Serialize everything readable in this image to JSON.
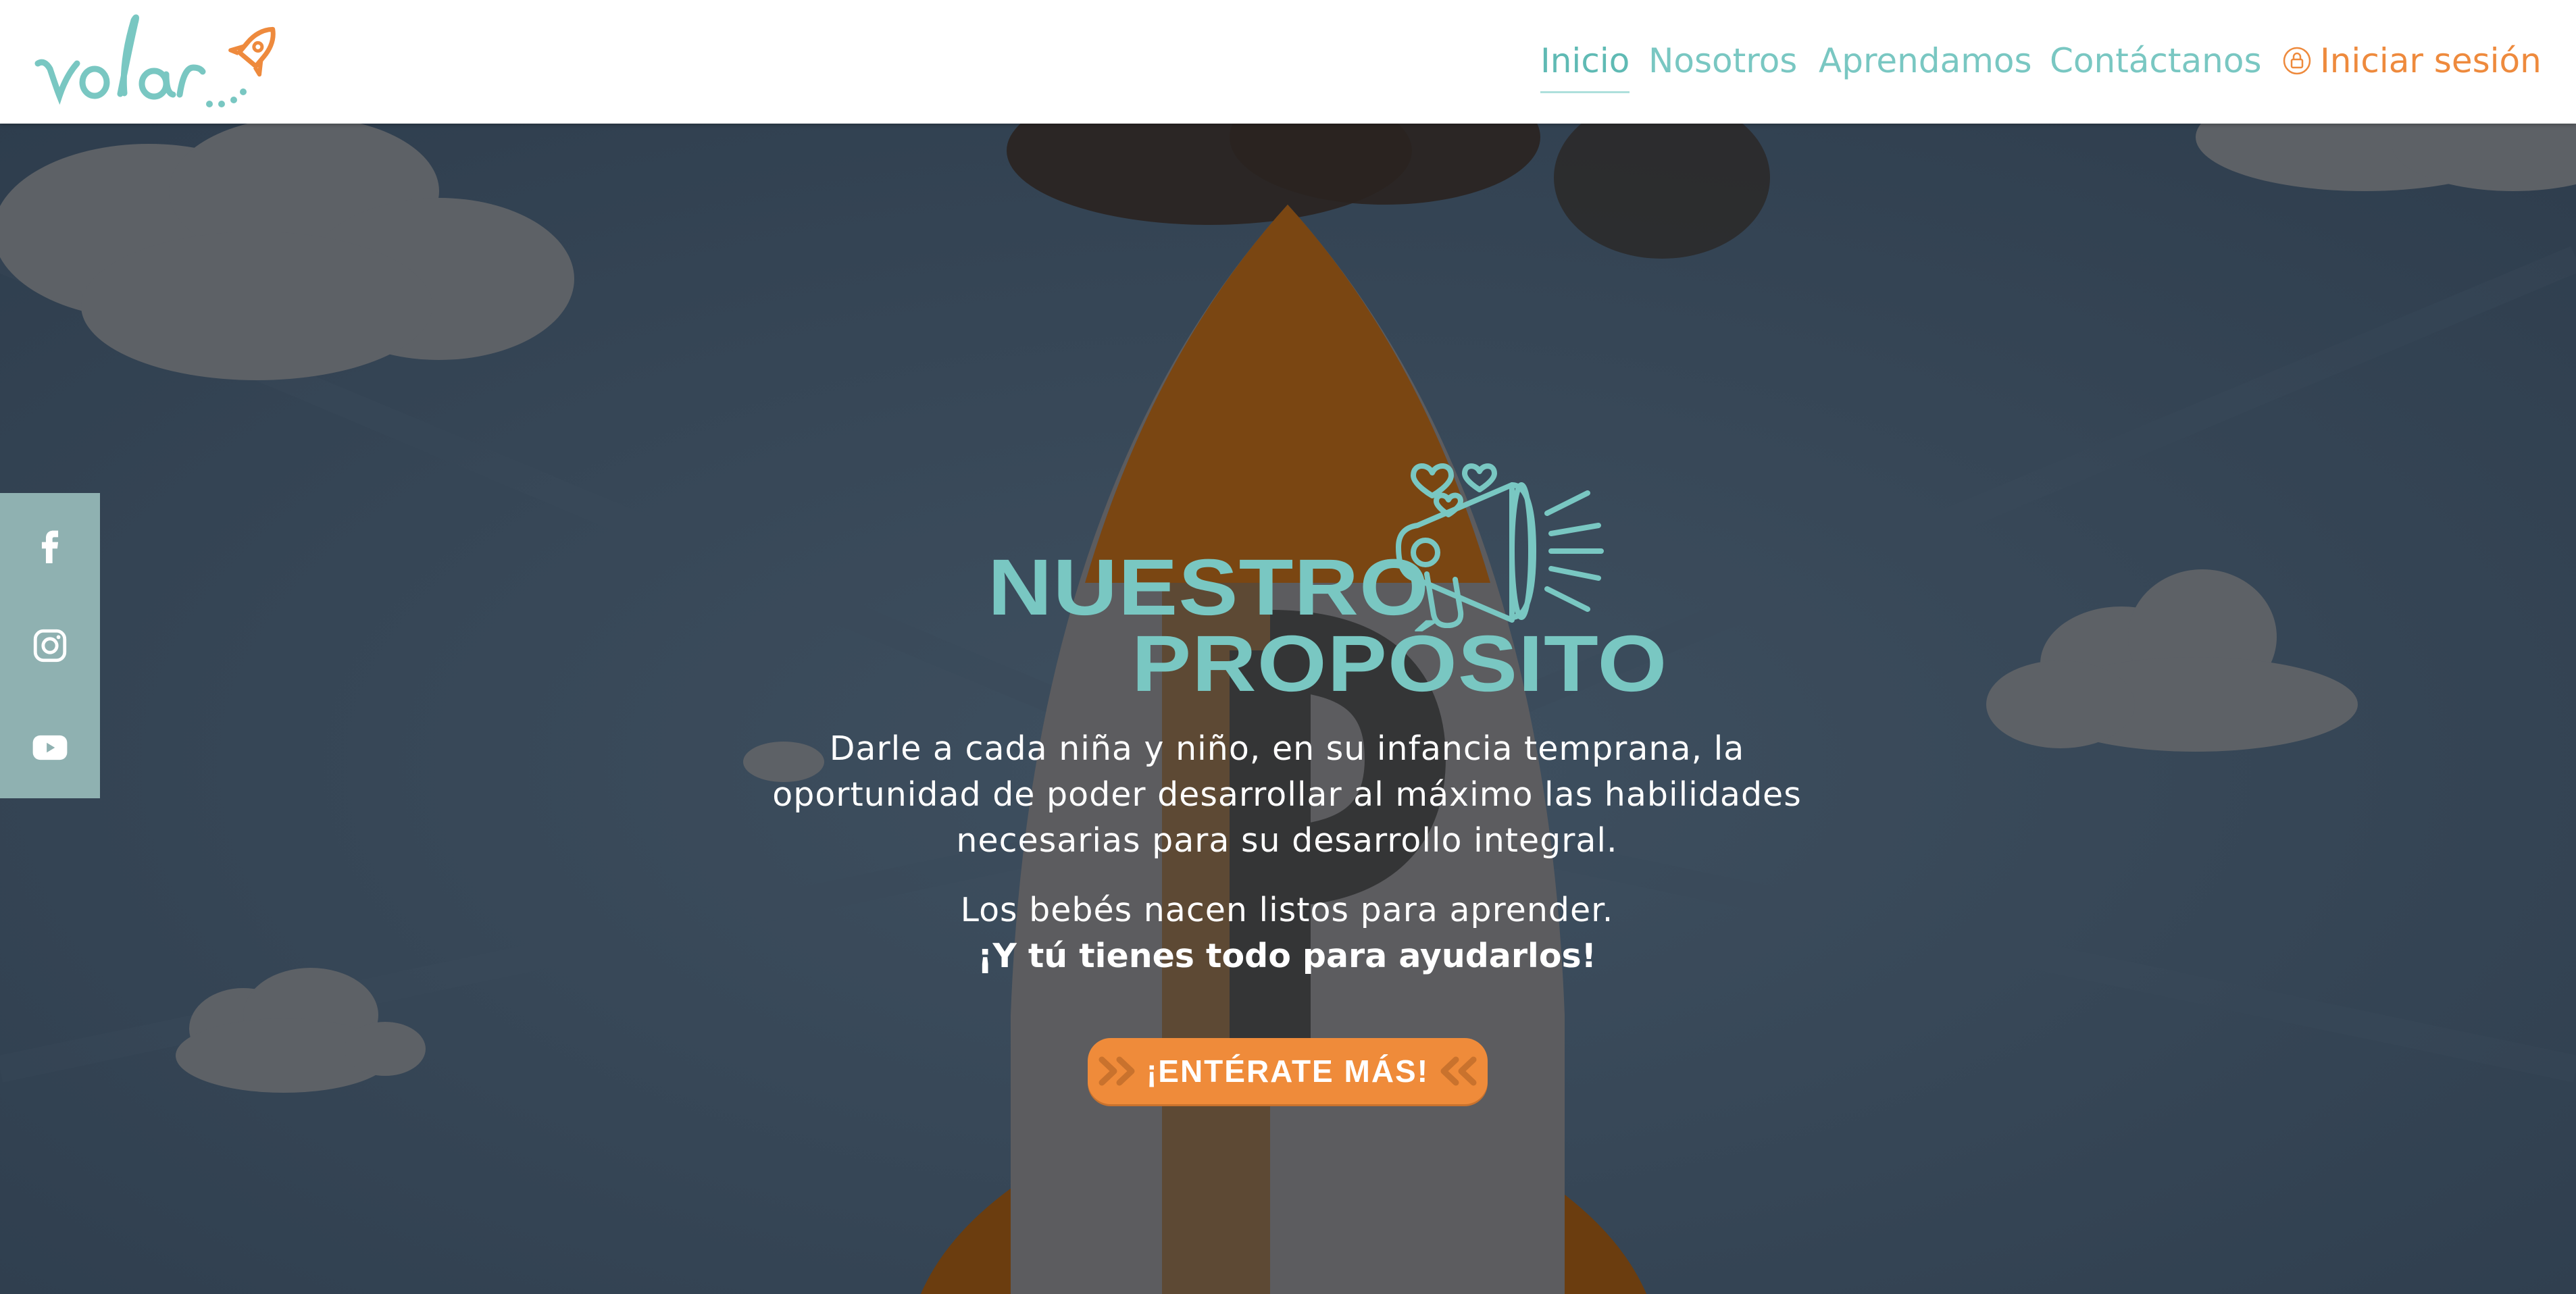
{
  "header": {
    "logo_text": "volar",
    "nav": [
      {
        "label": "Inicio",
        "active": true
      },
      {
        "label": "Nosotros",
        "active": false
      },
      {
        "label": "Aprendamos",
        "active": false
      },
      {
        "label": "Contáctanos",
        "active": false
      }
    ],
    "login_label": "Iniciar sesión"
  },
  "social": {
    "items": [
      {
        "icon": "facebook-icon"
      },
      {
        "icon": "instagram-icon"
      },
      {
        "icon": "youtube-icon"
      }
    ]
  },
  "hero": {
    "title_line1": "NUESTRO",
    "title_line2": "PROPÓSITO",
    "description": "Darle a cada niña y niño, en su infancia temprana, la oportunidad de poder desarrollar al máximo las habilidades necesarias para su desarrollo integral.",
    "subtitle": "Los bebés nacen listos para aprender.",
    "tagline": "¡Y tú tienes todo para ayudarlos!",
    "cta_label": "¡ENTÉRATE MÁS!"
  },
  "colors": {
    "teal": "#79c7c2",
    "orange": "#ef8b3a",
    "sidebar": "#8fb1b1",
    "hero_overlay": "#3a4650"
  }
}
